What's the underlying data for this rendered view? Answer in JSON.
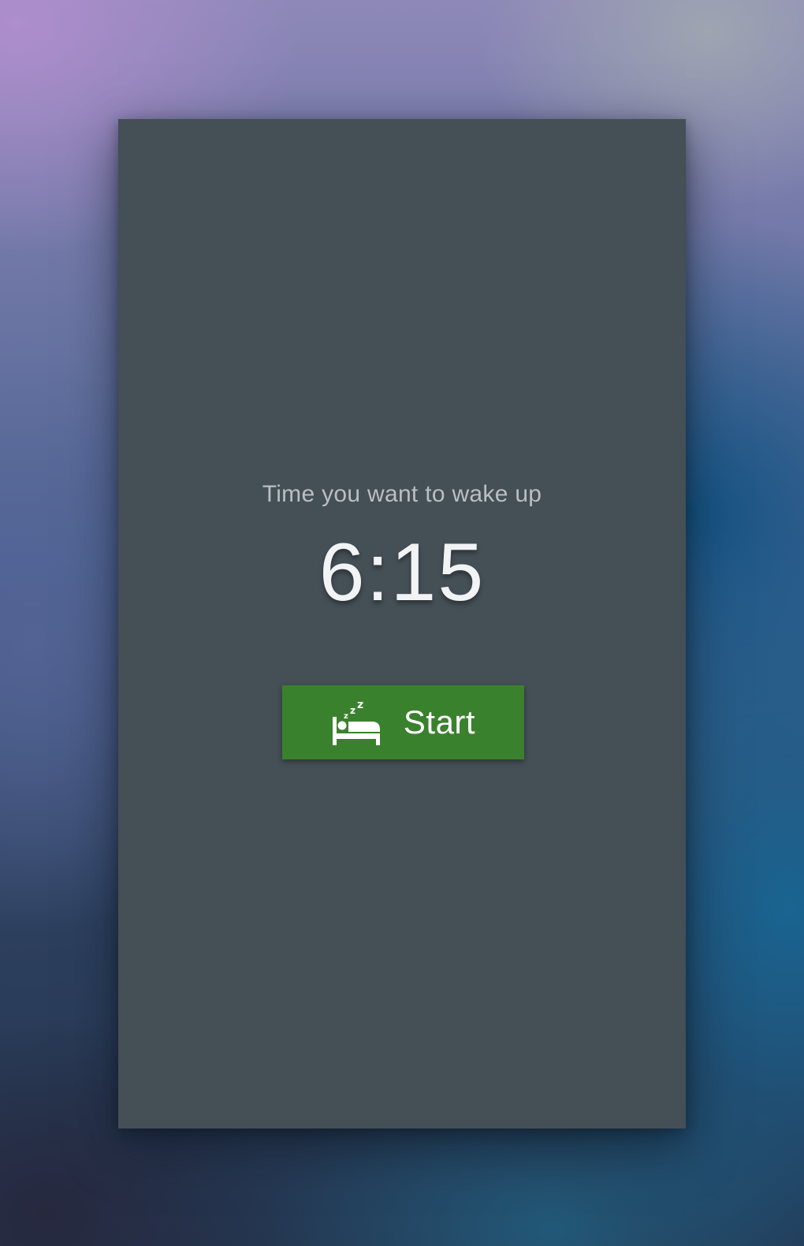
{
  "alarm": {
    "prompt": "Time you want to wake up",
    "wake_time": "6:15",
    "start_label": "Start",
    "start_icon": "bed-sleep-icon"
  },
  "colors": {
    "card_background": "#444f56",
    "start_button": "#3a812e",
    "prompt_text": "#b9bfc3",
    "time_text": "#f2f3f4"
  }
}
